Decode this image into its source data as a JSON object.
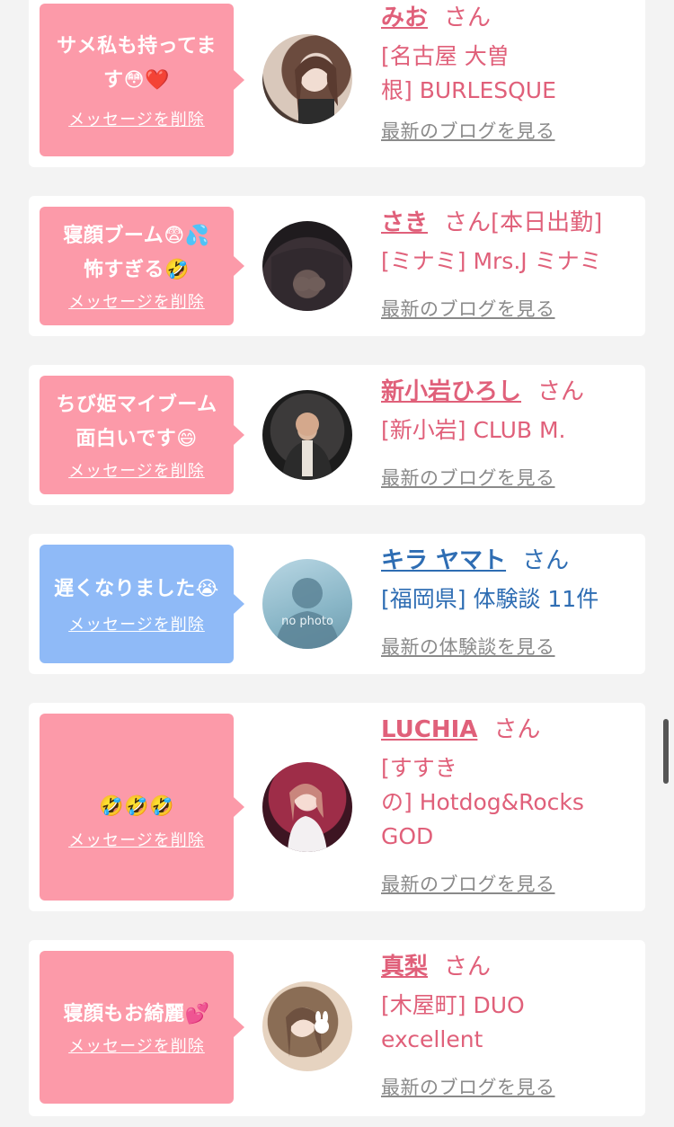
{
  "entries": [
    {
      "message": "サメ私も持ってま\nす😳❤️",
      "delete_label": "メッセージを削除",
      "name": "みお",
      "honorific": "さん",
      "shop": "[名古屋 大曽\n根] BURLESQUE",
      "more_link": "最新のブログを見る",
      "bubble_color": "#fc9aa9",
      "avatar_icon": "woman-photo"
    },
    {
      "message": "寝顔ブーム😨💦\n怖すぎる🤣",
      "delete_label": "メッセージを削除",
      "name": "さき",
      "honorific": "さん[本日出勤]",
      "shop": "[ミナミ] Mrs.J ミナミ",
      "more_link": "最新のブログを見る",
      "bubble_color": "#fc9aa9",
      "avatar_icon": "woman-photo"
    },
    {
      "message": "ちび姫マイブーム\n面白いです😄",
      "delete_label": "メッセージを削除",
      "name": "新小岩ひろし",
      "honorific": "さん",
      "shop": "[新小岩] CLUB M.",
      "more_link": "最新のブログを見る",
      "bubble_color": "#fc9aa9",
      "avatar_icon": "man-photo"
    },
    {
      "message": "遅くなりました😭",
      "delete_label": "メッセージを削除",
      "name": "キラ ヤマト",
      "honorific": "さん",
      "shop": "[福岡県] 体験談 11件",
      "more_link": "最新の体験談を見る",
      "bubble_color": "#8fbaf7",
      "avatar_icon": "no-photo-placeholder",
      "avatar_text": "no photo"
    },
    {
      "message": "🤣🤣🤣",
      "delete_label": "メッセージを削除",
      "name": "LUCHIA",
      "honorific": "さん",
      "shop": "[すすき\nの] Hotdog&Rocks\nGOD",
      "more_link": "最新のブログを見る",
      "bubble_color": "#fc9aa9",
      "avatar_icon": "woman-photo"
    },
    {
      "message": "寝顔もお綺麗💕",
      "delete_label": "メッセージを削除",
      "name": "真梨",
      "honorific": "さん",
      "shop": "[木屋町] DUO\nexcellent",
      "more_link": "最新のブログを見る",
      "bubble_color": "#fc9aa9",
      "avatar_icon": "woman-photo"
    }
  ],
  "colors": {
    "pink_text": "#e0607a",
    "blue_text": "#2e6db3",
    "link_gray": "#8a8a8a",
    "page_bg": "#f3f3f3"
  }
}
